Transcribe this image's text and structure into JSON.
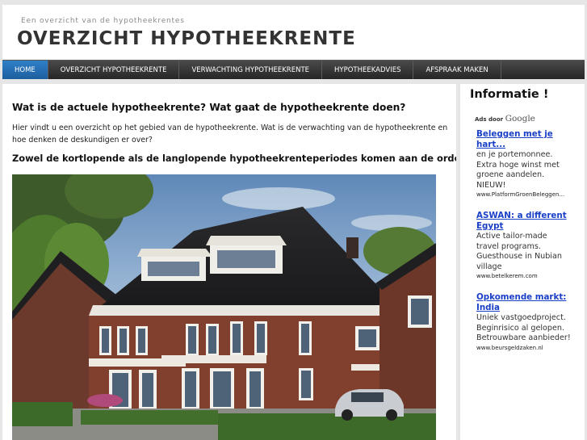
{
  "header": {
    "tagline": "Een overzicht van de hypotheekrentes",
    "title": "OVERZICHT HYPOTHEEKRENTE"
  },
  "nav": {
    "items": [
      {
        "label": "HOME"
      },
      {
        "label": "OVERZICHT HYPOTHEEKRENTE"
      },
      {
        "label": "VERWACHTING HYPOTHEEKRENTE"
      },
      {
        "label": "HYPOTHEEKADVIES"
      },
      {
        "label": "AFSPRAAK MAKEN"
      }
    ]
  },
  "main": {
    "heading": "Wat is de actuele hypotheekrente? Wat gaat de hypotheekrente doen?",
    "intro": "Hier vindt u een overzicht op het gebied van de hypotheekrente. Wat is de verwachting van de hypotheekrente en hoe denken de deskundigen er over?",
    "subheading": "Zowel de kortlopende als de langlopende hypotheekrenteperiodes komen aan de orde."
  },
  "sidebar": {
    "title": "Informatie !",
    "ads_by": "Ads door",
    "google": "Google",
    "ads": [
      {
        "title": "Beleggen met je hart...",
        "body": "en je portemonnee. Extra hoge winst met groene aandelen. NIEUW!",
        "url": "www.PlatformGroenBeleggen..."
      },
      {
        "title": "ASWAN: a different Egypt",
        "body": "Active tailor-made travel programs. Guesthouse in Nubian village",
        "url": "www.betelkerem.com"
      },
      {
        "title": "Opkomende markt: India",
        "body": "Uniek vastgoedproject. Beginrisico al gelopen. Betrouwbare aanbieder!",
        "url": "www.beursgeldzaken.nl"
      }
    ]
  }
}
